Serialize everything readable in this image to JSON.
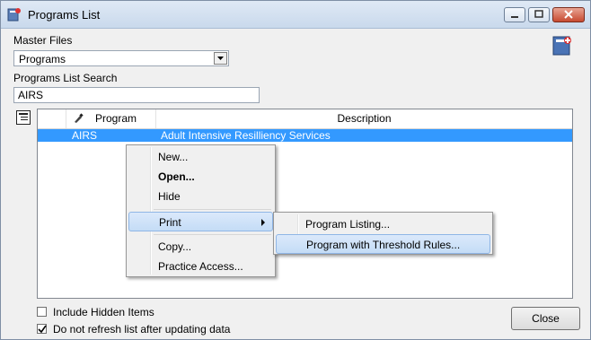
{
  "window": {
    "title": "Programs List"
  },
  "master_files": {
    "label": "Master Files",
    "selected": "Programs"
  },
  "search": {
    "label": "Programs List Search",
    "value": "AIRS"
  },
  "grid": {
    "columns": [
      "Program",
      "Description"
    ],
    "rows": [
      {
        "program": "AIRS",
        "description": "Adult Intensive Resilliency Services"
      }
    ]
  },
  "context_menu": {
    "items": [
      "New...",
      "Open...",
      "Hide",
      "Print",
      "Copy...",
      "Practice Access..."
    ]
  },
  "print_submenu": {
    "items": [
      "Program Listing...",
      "Program with Threshold Rules..."
    ]
  },
  "options": {
    "include_hidden": "Include Hidden Items",
    "include_hidden_checked": false,
    "no_refresh": "Do not refresh list after updating data",
    "no_refresh_checked": true
  },
  "buttons": {
    "close": "Close"
  },
  "colors": {
    "selection": "#3399ff",
    "titlebar": "#c9d9ec",
    "window_bg": "#f0f0f0"
  },
  "icons": [
    "app-icon",
    "minimize-icon",
    "maximize-icon",
    "window-close-icon",
    "help-book-icon",
    "grid-config-icon",
    "brush-icon",
    "dropdown-arrow-icon",
    "submenu-arrow-icon",
    "checkmark-icon"
  ]
}
